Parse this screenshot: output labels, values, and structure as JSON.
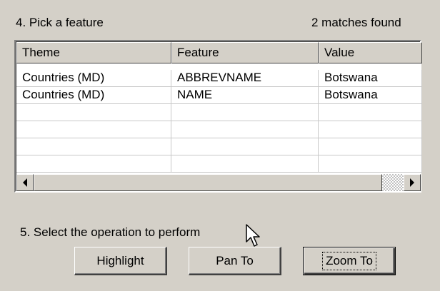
{
  "step4": {
    "label": "4. Pick a feature",
    "matches": "2 matches found"
  },
  "table": {
    "columns": [
      "Theme",
      "Feature",
      "Value"
    ],
    "rows": [
      [
        "Countries (MD)",
        "ABBREVNAME",
        "Botswana"
      ],
      [
        "Countries (MD)",
        "NAME",
        "Botswana"
      ],
      [
        "",
        "",
        ""
      ],
      [
        "",
        "",
        ""
      ],
      [
        "",
        "",
        ""
      ],
      [
        "",
        "",
        ""
      ]
    ]
  },
  "step5": {
    "label": "5. Select the operation to perform"
  },
  "buttons": {
    "highlight": "Highlight",
    "pan_to": "Pan To",
    "zoom_to": "Zoom To"
  },
  "icons": {
    "scroll_left": "arrow-left-icon",
    "scroll_right": "arrow-right-icon",
    "cursor": "mouse-pointer-icon"
  }
}
